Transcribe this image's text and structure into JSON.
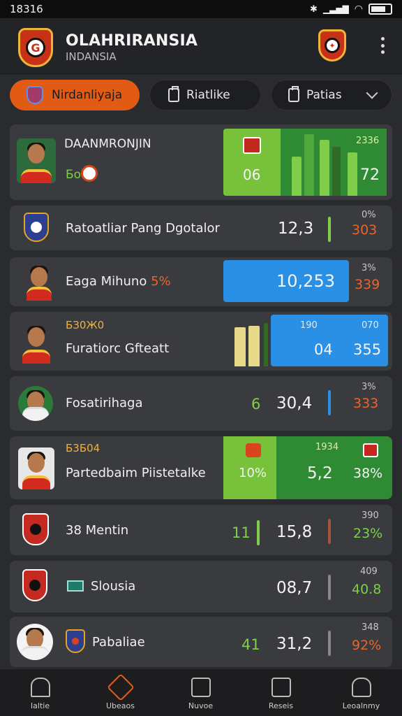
{
  "status": {
    "time": "18316"
  },
  "header": {
    "title": "OLAHRIRANSIA",
    "subtitle": "INDANSIA"
  },
  "filters": {
    "active_label": "Nirdanliyaja",
    "second_label": "Riatlike",
    "third_label": "Patias"
  },
  "rows": [
    {
      "name": "DAANMRONJIN",
      "sub": "Бо",
      "left_value": "06",
      "right_value": "72",
      "top_value": "2336"
    },
    {
      "name": "Ratoatliar Pang Dgotalor",
      "value": "12,3",
      "top": "0%",
      "pct": "303"
    },
    {
      "name": "Eaga Mihuno",
      "name_pct": "5%",
      "value": "10,253",
      "top": "3%",
      "pct": "339"
    },
    {
      "name": "Furatiorc Gfteatt",
      "sub": "БЗ0Ж0",
      "top_mid": "190",
      "top_right": "070",
      "left_value": "04",
      "right_value": "355"
    },
    {
      "name": "Fosatirihaga",
      "left_value": "6",
      "value": "30,4",
      "top": "3%",
      "pct": "333"
    },
    {
      "name": "Partedbaim Piistetalke",
      "sub": "Б3Б04",
      "left_value": "10%",
      "top_mid": "1934",
      "value": "5,2",
      "pct": "38%"
    },
    {
      "name": "Mentin",
      "prefix": "38",
      "left_value": "11",
      "value": "15,8",
      "top": "390",
      "pct": "23%"
    },
    {
      "name": "Slousia",
      "value": "08,7",
      "top": "409",
      "pct": "40.8"
    },
    {
      "name": "Pabaliae",
      "left_value": "41",
      "value": "31,2",
      "top": "348",
      "pct": "92%"
    }
  ],
  "bottom_nav": [
    "Ialtie",
    "Ubeaos",
    "Nuvoe",
    "Reseis",
    "Leoalnmy"
  ],
  "colors": {
    "accent": "#e25b14",
    "green": "#7fce4a",
    "blue": "#2a90e6"
  }
}
